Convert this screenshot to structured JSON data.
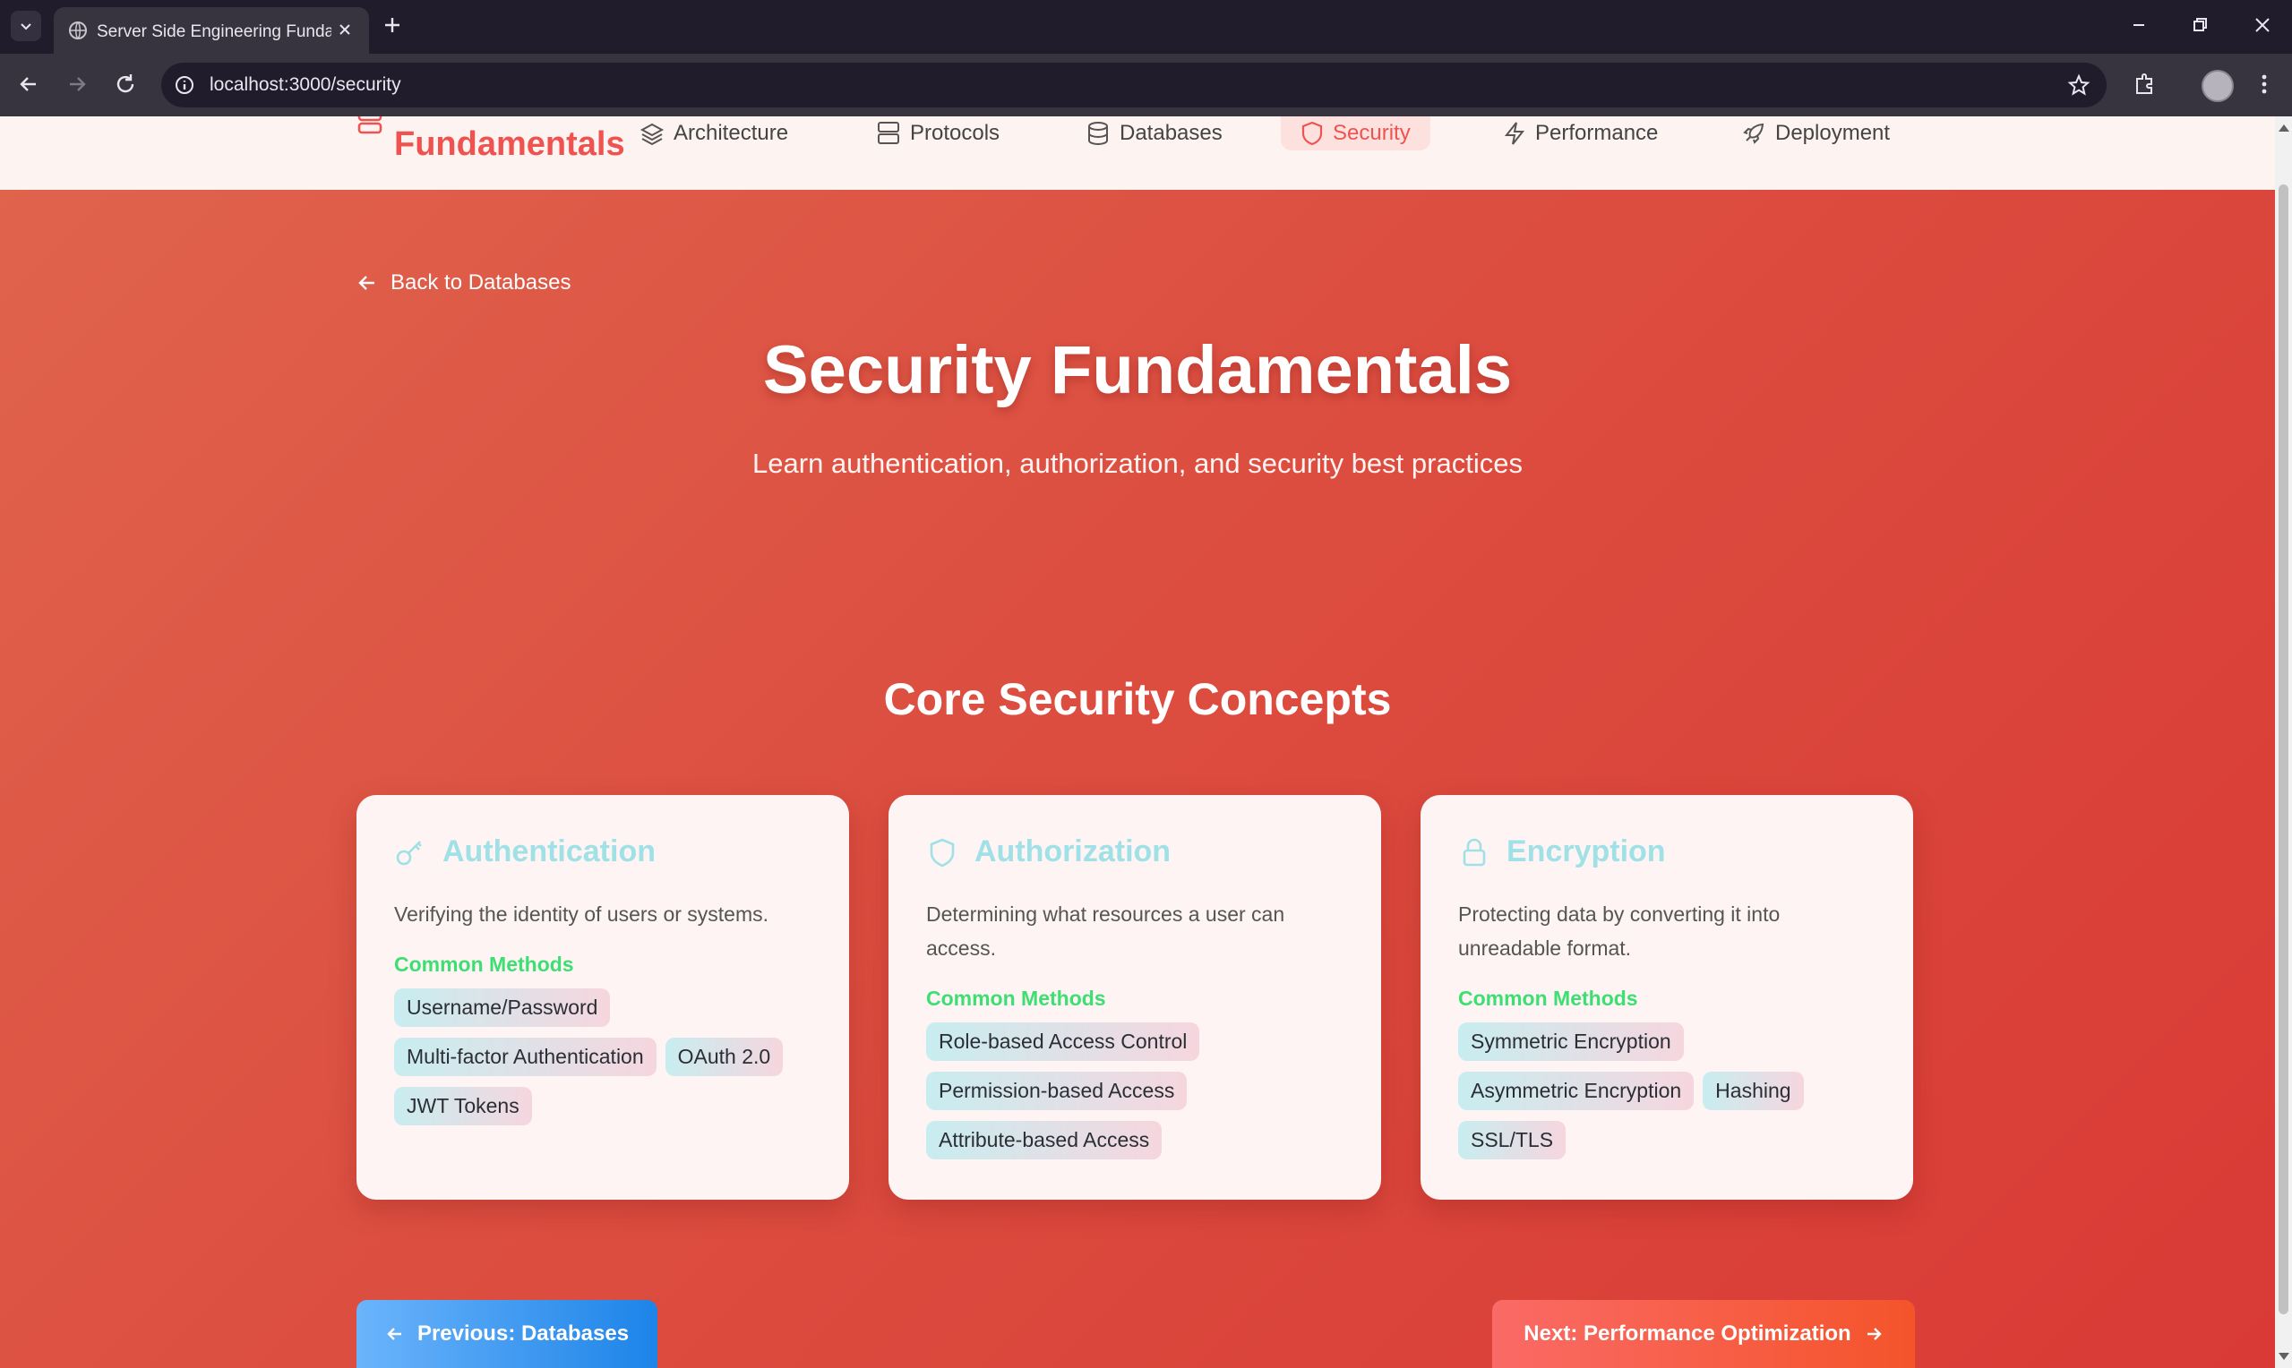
{
  "browser": {
    "tab_title": "Server Side Engineering Fundamentals",
    "url": "localhost:3000/security"
  },
  "site_nav": {
    "brand": "Fundamentals",
    "items": [
      {
        "label": "Architecture",
        "icon": "layers-icon"
      },
      {
        "label": "Protocols",
        "icon": "server-icon"
      },
      {
        "label": "Databases",
        "icon": "database-icon"
      },
      {
        "label": "Security",
        "icon": "shield-icon",
        "active": true
      },
      {
        "label": "Performance",
        "icon": "zap-icon"
      },
      {
        "label": "Deployment",
        "icon": "rocket-icon"
      }
    ]
  },
  "hero": {
    "back_link": "Back to Databases",
    "title": "Security Fundamentals",
    "subtitle": "Learn authentication, authorization, and security best practices"
  },
  "concepts": {
    "section_title": "Core Security Concepts",
    "methods_label": "Common Methods",
    "cards": [
      {
        "title": "Authentication",
        "icon": "key-icon",
        "description": "Verifying the identity of users or systems.",
        "methods": [
          "Username/Password",
          "Multi-factor Authentication",
          "OAuth 2.0",
          "JWT Tokens"
        ]
      },
      {
        "title": "Authorization",
        "icon": "shield-icon",
        "description": "Determining what resources a user can access.",
        "methods": [
          "Role-based Access Control",
          "Permission-based Access",
          "Attribute-based Access"
        ]
      },
      {
        "title": "Encryption",
        "icon": "lock-icon",
        "description": "Protecting data by converting it into unreadable format.",
        "methods": [
          "Symmetric Encryption",
          "Asymmetric Encryption",
          "Hashing",
          "SSL/TLS"
        ]
      }
    ]
  },
  "pager": {
    "prev_label": "Previous: Databases",
    "next_label": "Next: Performance Optimization"
  },
  "colors": {
    "accent": "#ef5350",
    "card_title": "#9fe1e6",
    "methods_label": "#3ddf73",
    "prev_button": "#1d84e8",
    "next_button": "#f4542a"
  }
}
